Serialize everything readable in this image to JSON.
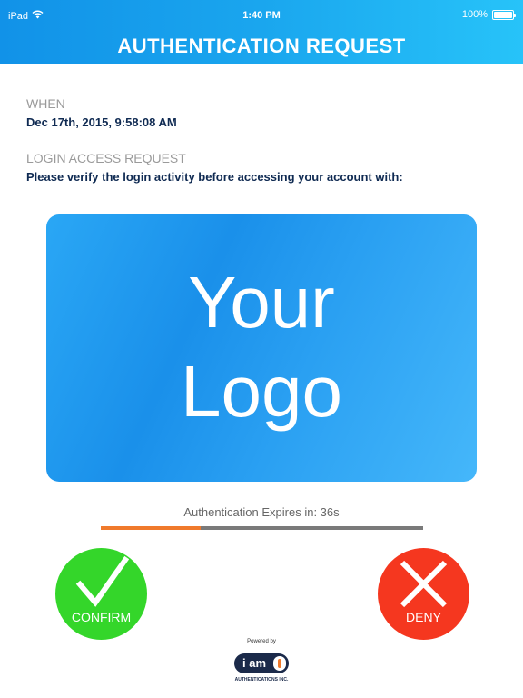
{
  "status_bar": {
    "device": "iPad",
    "time": "1:40 PM",
    "battery": "100%"
  },
  "header": {
    "title": "AUTHENTICATION REQUEST"
  },
  "when": {
    "label": "WHEN",
    "value": "Dec 17th, 2015, 9:58:08 AM"
  },
  "login_request": {
    "label": "LOGIN ACCESS REQUEST",
    "value": "Please verify the login activity before accessing your account with:"
  },
  "logo_card": {
    "line1": "Your",
    "line2": "Logo"
  },
  "expiry": {
    "text": "Authentication Expires in: 36s",
    "progress": 0.31
  },
  "actions": {
    "confirm_label": "CONFIRM",
    "deny_label": "DENY"
  },
  "footer": {
    "powered_by": "Powered by",
    "brand": "i am",
    "company": "AUTHENTICATIONS INC."
  },
  "colors": {
    "header_start": "#1192e8",
    "header_end": "#27c3f9",
    "confirm": "#34d62a",
    "deny": "#f5371f",
    "progress": "#f07a2c",
    "track": "#7a7a7a"
  }
}
